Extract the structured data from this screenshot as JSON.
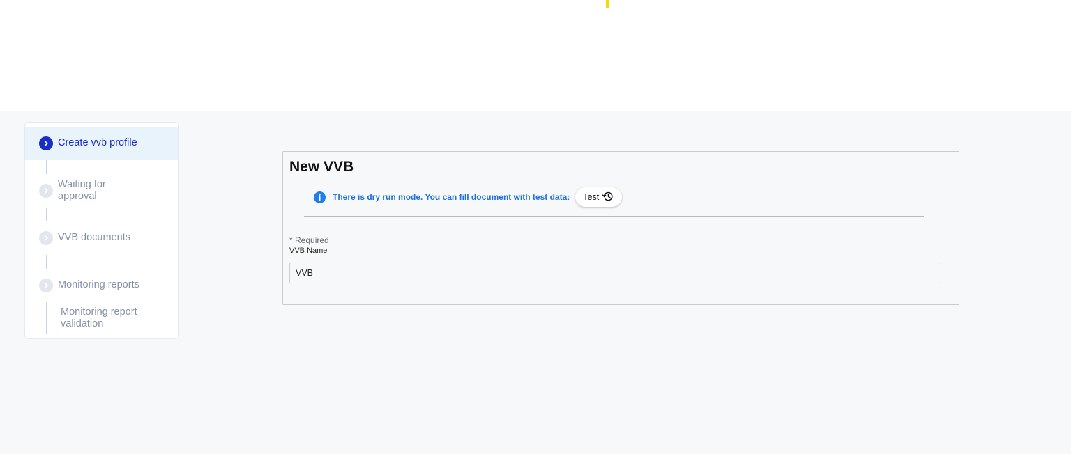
{
  "stepper": {
    "steps": [
      {
        "label": "Create vvb profile",
        "state": "active"
      },
      {
        "label": "Waiting for approval",
        "state": "inactive"
      },
      {
        "label": "VVB documents",
        "state": "inactive"
      },
      {
        "label": "Monitoring reports",
        "state": "inactive"
      }
    ],
    "substeps": [
      {
        "label": "Monitoring report validation"
      }
    ]
  },
  "form": {
    "title": "New VVB",
    "dry_run_message": "There is dry run mode. You can fill document with test data:",
    "test_button_label": "Test",
    "required_note": "* Required",
    "fields": [
      {
        "label": "VVB Name",
        "value": "VVB"
      }
    ]
  },
  "colors": {
    "accent": "#1a2ec7",
    "info": "#1f7ee8",
    "active_step_bg": "#e9f3fc",
    "content_bg": "#f7f8fa",
    "top_marker": "#f5d80a"
  }
}
